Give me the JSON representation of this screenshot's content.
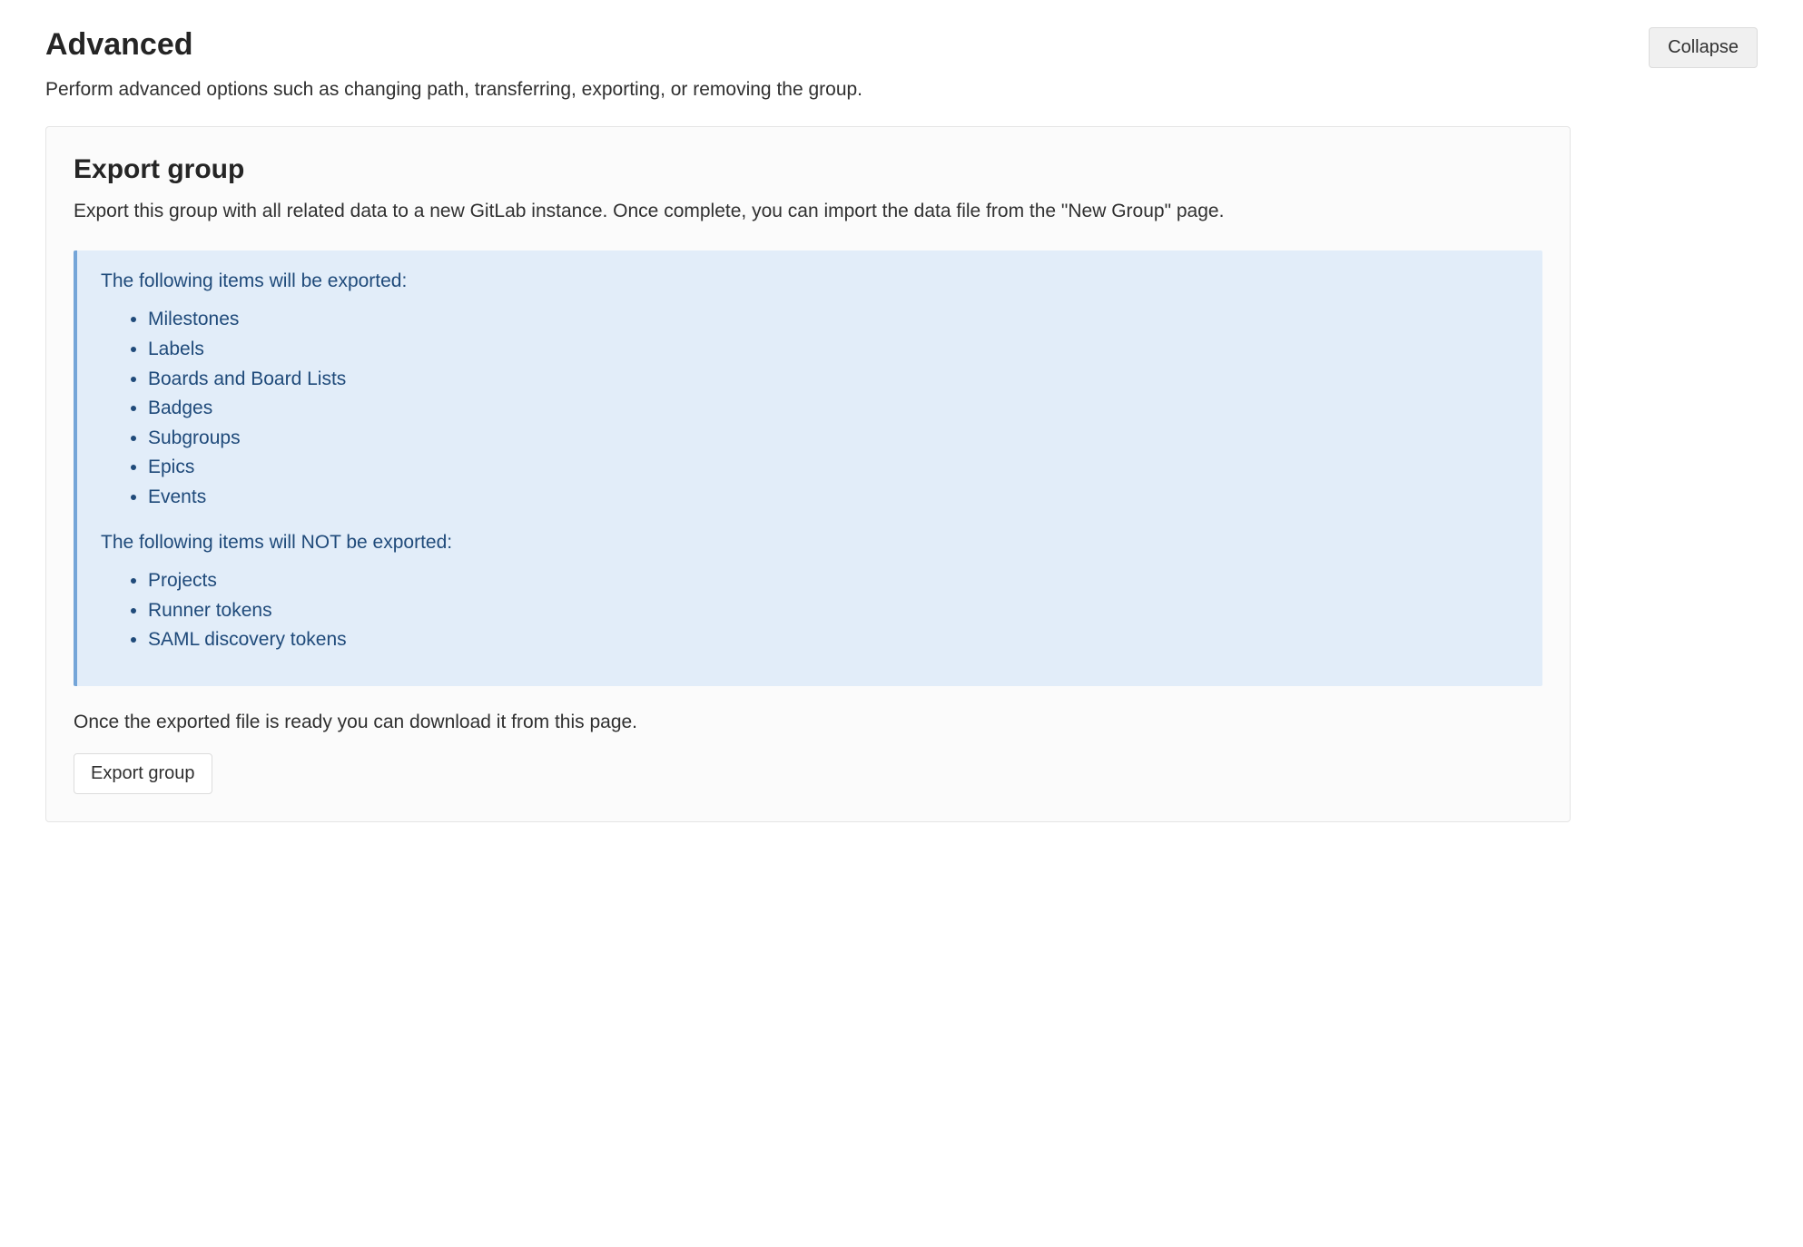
{
  "header": {
    "title": "Advanced",
    "collapse_label": "Collapse",
    "subtext": "Perform advanced options such as changing path, transferring, exporting, or removing the group."
  },
  "export": {
    "title": "Export group",
    "description": "Export this group with all related data to a new GitLab instance. Once complete, you can import the data file from the \"New Group\" page.",
    "exported_heading": "The following items will be exported:",
    "exported_items": [
      "Milestones",
      "Labels",
      "Boards and Board Lists",
      "Badges",
      "Subgroups",
      "Epics",
      "Events"
    ],
    "not_exported_heading": "The following items will NOT be exported:",
    "not_exported_items": [
      "Projects",
      "Runner tokens",
      "SAML discovery tokens"
    ],
    "ready_text": "Once the exported file is ready you can download it from this page.",
    "button_label": "Export group"
  }
}
